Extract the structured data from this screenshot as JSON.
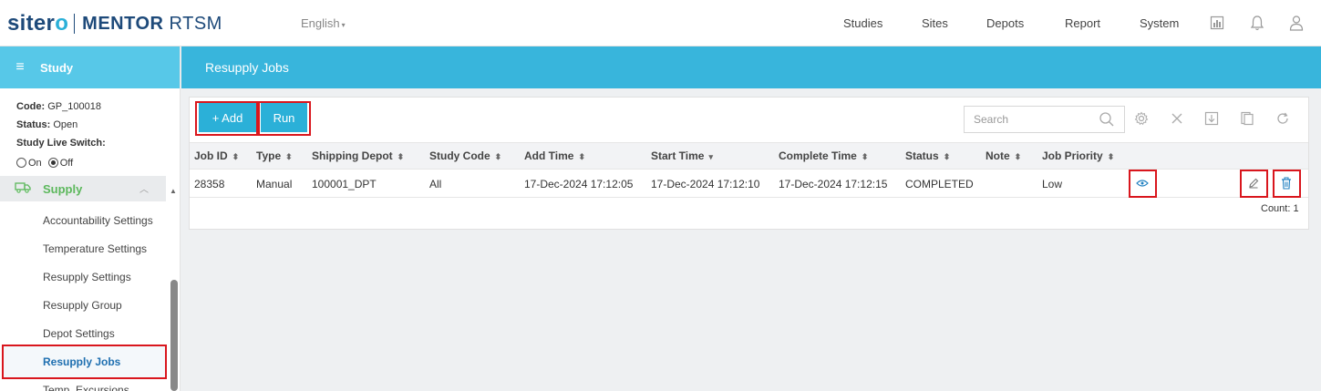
{
  "header": {
    "brand_left": "siter",
    "brand_accent": "o",
    "product_bold": "MENTOR",
    "product_rest": "RTSM",
    "language": "English",
    "nav": [
      "Studies",
      "Sites",
      "Depots",
      "Report",
      "System"
    ]
  },
  "sidebar": {
    "title": "Study",
    "study": {
      "code_label": "Code:",
      "code": "GP_100018",
      "status_label": "Status:",
      "status": "Open",
      "switch_label": "Study Live Switch:",
      "on_label": "On",
      "off_label": "Off",
      "selected": "Off"
    },
    "section": "Supply",
    "items": [
      "Accountability Settings",
      "Temperature Settings",
      "Resupply Settings",
      "Resupply Group",
      "Depot Settings",
      "Resupply Jobs",
      "Temp. Excursions"
    ],
    "active_item": "Resupply Jobs"
  },
  "page": {
    "title": "Resupply Jobs",
    "add_label": "+ Add",
    "run_label": "Run",
    "search_placeholder": "Search"
  },
  "table": {
    "columns": [
      "Job ID",
      "Type",
      "Shipping Depot",
      "Study Code",
      "Add Time",
      "Start Time",
      "Complete Time",
      "Status",
      "Note",
      "Job Priority"
    ],
    "sort_column": "Start Time",
    "sort_direction": "descending",
    "rows": [
      {
        "job_id": "28358",
        "type": "Manual",
        "shipping_depot": "100001_DPT",
        "study_code": "All",
        "add_time": "17-Dec-2024 17:12:05",
        "start_time": "17-Dec-2024 17:12:10",
        "complete_time": "17-Dec-2024 17:12:15",
        "status": "COMPLETED",
        "note": "",
        "job_priority": "Low"
      }
    ],
    "count_text": "Count: 1"
  },
  "colors": {
    "accent": "#38b5dc",
    "button": "#2bb0d8",
    "highlight": "#d9161d",
    "supply": "#5cb85c",
    "link_active": "#1e6fb0"
  }
}
